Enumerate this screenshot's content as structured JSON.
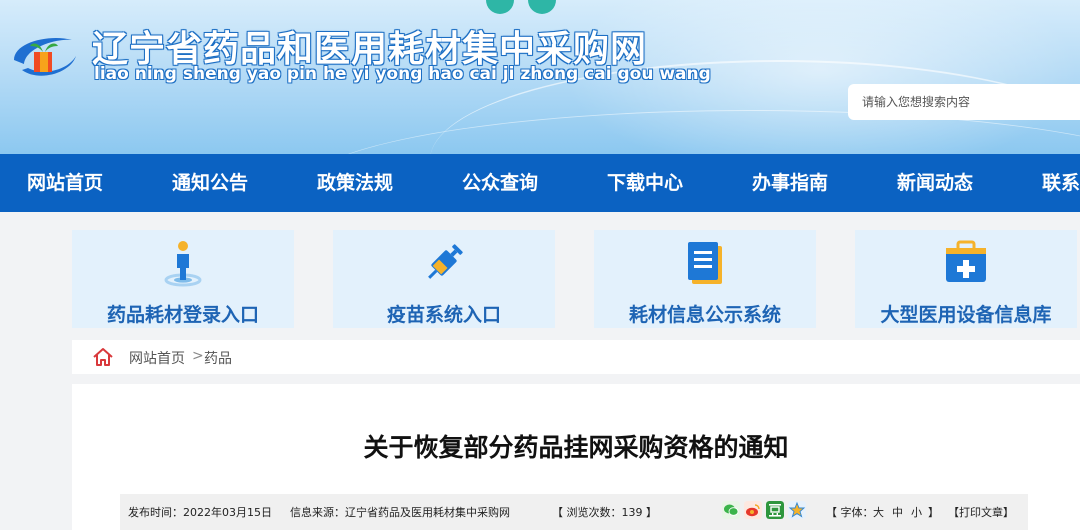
{
  "header": {
    "title": "辽宁省药品和医用耗材集中采购网",
    "pinyin": "liao ning sheng yao pin he yi yong hao cai ji zhong cai gou wang",
    "search_placeholder": "请输入您想搜索内容"
  },
  "nav": {
    "items": [
      "网站首页",
      "通知公告",
      "政策法规",
      "公众查询",
      "下载中心",
      "办事指南",
      "新闻动态",
      "联系"
    ]
  },
  "cards": [
    {
      "label": "药品耗材登录入口",
      "icon": "person-pin-icon"
    },
    {
      "label": "疫苗系统入口",
      "icon": "syringe-icon"
    },
    {
      "label": "耗材信息公示系统",
      "icon": "document-icon"
    },
    {
      "label": "大型医用设备信息库",
      "icon": "medical-kit-icon"
    }
  ],
  "breadcrumb": {
    "home": "网站首页",
    "separator": ">",
    "current": "药品"
  },
  "article": {
    "title": "关于恢复部分药品挂网采购资格的通知",
    "publish_label": "发布时间：2022年03月15日",
    "source_label": "信息来源：辽宁省药品及医用耗材集中采购网",
    "views_label": "【 浏览次数：139 】",
    "font_label": "【 字体：",
    "font_large": "大",
    "font_medium": "中",
    "font_small": "小",
    "font_close": "】",
    "print_label": "【打印文章】"
  },
  "colors": {
    "nav_bg": "#0b62c2",
    "card_bg": "#e3f1fc",
    "card_text": "#1e64b4",
    "home_icon": "#d9393c"
  }
}
